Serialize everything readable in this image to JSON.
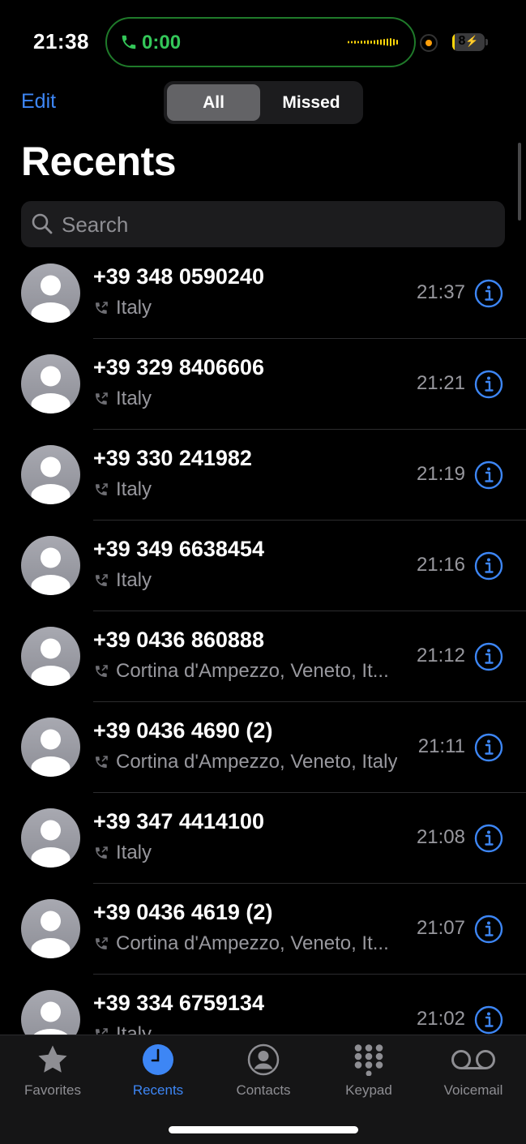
{
  "status_bar": {
    "time": "21:38",
    "call_timer": "0:00",
    "battery_level": "8",
    "battery_percent": 8,
    "call_color": "#34c759"
  },
  "header": {
    "edit_label": "Edit",
    "segments": [
      "All",
      "Missed"
    ],
    "selected_segment": "All",
    "title": "Recents"
  },
  "search": {
    "placeholder": "Search"
  },
  "calls": [
    {
      "number": "+39 348 0590240",
      "location": "Italy",
      "time": "21:37"
    },
    {
      "number": "+39 329 8406606",
      "location": "Italy",
      "time": "21:21"
    },
    {
      "number": "+39 330 241982",
      "location": "Italy",
      "time": "21:19"
    },
    {
      "number": "+39 349 6638454",
      "location": "Italy",
      "time": "21:16"
    },
    {
      "number": "+39 0436 860888",
      "location": "Cortina d'Ampezzo, Veneto, It...",
      "time": "21:12"
    },
    {
      "number": "+39 0436 4690 (2)",
      "location": "Cortina d'Ampezzo, Veneto, Italy",
      "time": "21:11"
    },
    {
      "number": "+39 347 4414100",
      "location": "Italy",
      "time": "21:08"
    },
    {
      "number": "+39 0436 4619 (2)",
      "location": "Cortina d'Ampezzo, Veneto, It...",
      "time": "21:07"
    },
    {
      "number": "+39 334 6759134",
      "location": "Italy",
      "time": "21:02"
    }
  ],
  "tabs": [
    {
      "label": "Favorites",
      "icon": "star-icon",
      "active": false
    },
    {
      "label": "Recents",
      "icon": "clock-icon",
      "active": true
    },
    {
      "label": "Contacts",
      "icon": "person-circle-icon",
      "active": false
    },
    {
      "label": "Keypad",
      "icon": "keypad-icon",
      "active": false
    },
    {
      "label": "Voicemail",
      "icon": "voicemail-icon",
      "active": false
    }
  ],
  "colors": {
    "accent": "#3d86f5",
    "background": "#000000",
    "secondary_text": "#98989e"
  }
}
